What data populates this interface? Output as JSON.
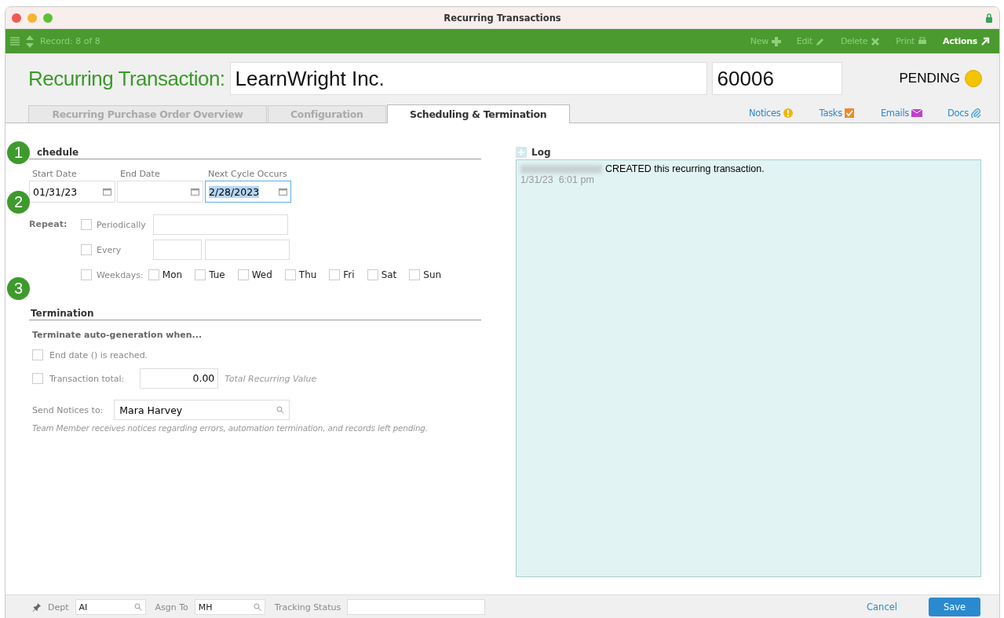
{
  "window": {
    "title": "Recurring Transactions"
  },
  "toolbar": {
    "record": "Record: 8 of 8",
    "actions": [
      {
        "label": "New",
        "kind": "new",
        "disabled": true
      },
      {
        "label": "Edit",
        "kind": "edit",
        "disabled": true
      },
      {
        "label": "Delete",
        "kind": "delete",
        "disabled": true
      },
      {
        "label": "Print",
        "kind": "print",
        "disabled": true
      },
      {
        "label": "Actions",
        "kind": "actions",
        "disabled": false
      }
    ]
  },
  "header": {
    "title": "Recurring Transaction:",
    "name": "LearnWright Inc.",
    "number": "60006",
    "status": "PENDING"
  },
  "tabs": [
    {
      "label": "Recurring Purchase Order Overview",
      "selected": false
    },
    {
      "label": "Configuration",
      "selected": false
    },
    {
      "label": "Scheduling & Termination",
      "selected": true
    }
  ],
  "links": [
    {
      "label": "Notices",
      "kind": "notices"
    },
    {
      "label": "Tasks",
      "kind": "tasks"
    },
    {
      "label": "Emails",
      "kind": "emails"
    },
    {
      "label": "Docs",
      "kind": "docs"
    }
  ],
  "callouts": [
    "1",
    "2",
    "3"
  ],
  "schedule": {
    "heading": "chedule",
    "dates": [
      {
        "label": "Start Date",
        "value": "01/31/23",
        "selected": false
      },
      {
        "label": "End Date",
        "selected": false
      },
      {
        "label": "Next Cycle Occurs",
        "value": "2/28/2023",
        "selected": true
      }
    ],
    "repeat_label": "Repeat:",
    "repeat": [
      {
        "label": "Periodically",
        "kind": "periodic",
        "checked": false
      },
      {
        "label": "Every",
        "kind": "every",
        "checked": false
      },
      {
        "label": "Weekdays:",
        "kind": "weekdays",
        "checked": false,
        "days": [
          {
            "label": "Mon",
            "checked": false
          },
          {
            "label": "Tue",
            "checked": false
          },
          {
            "label": "Wed",
            "checked": false
          },
          {
            "label": "Thu",
            "checked": false
          },
          {
            "label": "Fri",
            "checked": false
          },
          {
            "label": "Sat",
            "checked": false
          },
          {
            "label": "Sun",
            "checked": false
          }
        ]
      }
    ]
  },
  "termination": {
    "heading": "Termination",
    "subheading": "Terminate auto-generation when...",
    "options": [
      {
        "label": "End date () is reached.",
        "kind": "plain",
        "checked": false
      },
      {
        "label": "Transaction total:",
        "kind": "amount",
        "checked": false,
        "value": "0.00",
        "hint": "Total Recurring Value"
      }
    ],
    "notices_label": "Send Notices to:",
    "notices_value": "Mara Harvey",
    "help": "Team Member receives notices regarding errors, automation termination, and records left pending."
  },
  "log": {
    "title": "Log",
    "entries": [
      {
        "text": "CREATED this recurring transaction.",
        "time": "1/31/23  6:01 pm"
      }
    ]
  },
  "footer": {
    "fields": [
      {
        "label": "Dept",
        "value": "AI",
        "kind": "lookup"
      },
      {
        "label": "Asgn To",
        "value": "MH",
        "kind": "lookup"
      },
      {
        "label": "Tracking Status",
        "kind": "text"
      }
    ],
    "cancel": "Cancel",
    "save": "Save"
  }
}
